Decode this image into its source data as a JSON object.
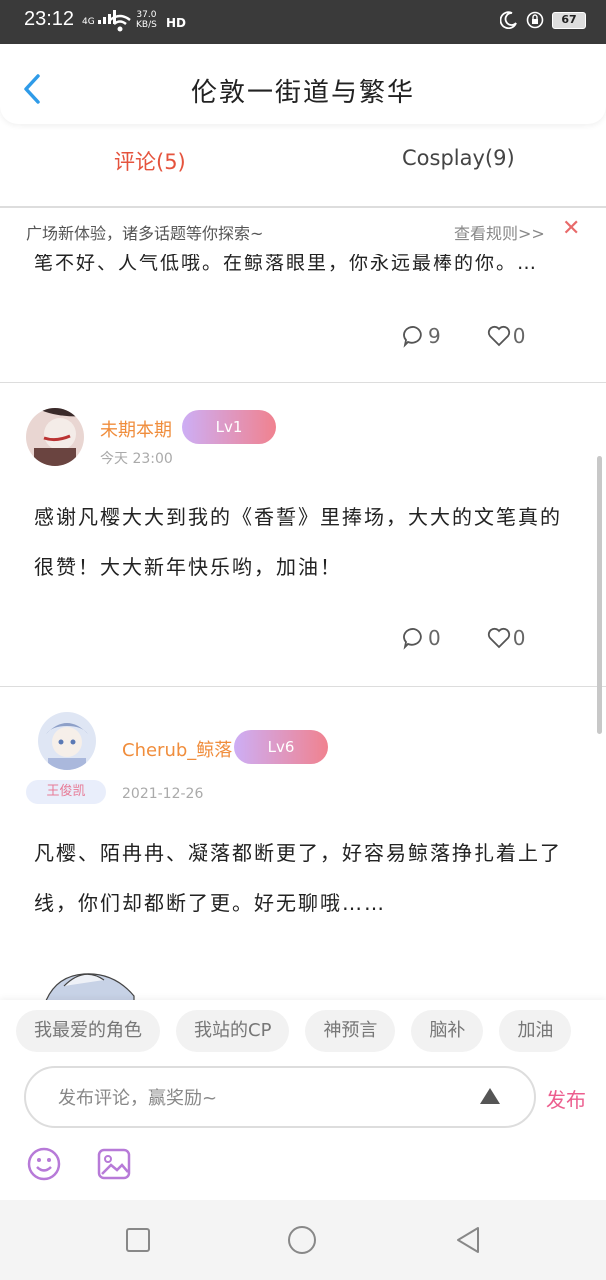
{
  "status": {
    "time": "23:12",
    "net_top": "4G",
    "speed_top": "37.0",
    "speed_bottom": "KB/S",
    "hd": "HD",
    "battery": "67"
  },
  "header": {
    "title": "伦敦一街道与繁华"
  },
  "tabs": [
    {
      "label": "评论(5)",
      "active": true
    },
    {
      "label": "Cosplay(9)",
      "active": false
    }
  ],
  "notice": {
    "text": "广场新体验，诸多话题等你探索~",
    "rules": "查看规则>>",
    "close": "✕"
  },
  "partial_comment": {
    "text": "笔不好、人气低哦。在鲸落眼里，你永远最棒的你。…",
    "comments": "9",
    "likes": "0"
  },
  "comments": [
    {
      "username": "未期本期",
      "level": "Lv1",
      "time": "今天 23:00",
      "text": "感谢凡樱大大到我的《香誓》里捧场，大大的文笔真的很赞！大大新年快乐哟，加油！",
      "comments": "0",
      "likes": "0"
    },
    {
      "username": "Cherub_鲸落",
      "level": "Lv6",
      "medal": "王俊凯",
      "time": "2021-12-26",
      "text": "凡樱、陌冉冉、凝落都断更了，好容易鲸落挣扎着上了线，你们却都断了更。好无聊哦……"
    }
  ],
  "composer": {
    "chips": [
      "我最爱的角色",
      "我站的CP",
      "神预言",
      "脑补",
      "加油"
    ],
    "placeholder": "发布评论，赢奖励~",
    "publish": "发布"
  },
  "colors": {
    "accent_red": "#e5533d",
    "username_orange": "#f08d3c",
    "publish_pink": "#ec5e8e",
    "back_blue": "#2f9be8"
  }
}
